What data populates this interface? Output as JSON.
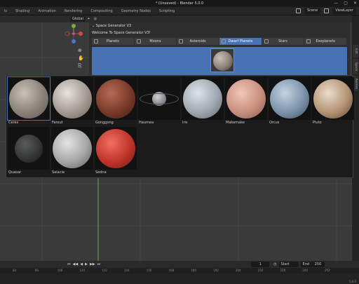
{
  "window": {
    "title": "* (Unsaved) - Blender 5.0.0",
    "controls": [
      "—",
      "▢",
      "✕"
    ]
  },
  "menubar": {
    "tabs": [
      "ls",
      "Shading",
      "Animation",
      "Rendering",
      "Compositing",
      "Geometry Nodes",
      "Scripting"
    ],
    "active_tab": "Scripting",
    "scene_label": "Scene",
    "view_layer_label": "ViewLayer"
  },
  "viewport_header": {
    "orientation": "Global"
  },
  "right_tabs": [
    "Edit",
    "Space",
    "Animes"
  ],
  "panel": {
    "header": "Space Generator V3",
    "welcome": "Welcome To Space Generator V3!",
    "categories": [
      "Planets",
      "Moons",
      "Asteroids",
      "Dwarf Planets",
      "Stars",
      "Exoplanets"
    ],
    "selected_category": "Dwarf Planets"
  },
  "grid": {
    "items": [
      {
        "label": "Ceres",
        "colors": [
          "#c9c2b8",
          "#8a8279",
          "#5d5750"
        ],
        "selected": true
      },
      {
        "label": "Farout",
        "colors": [
          "#e6e2dd",
          "#a39b93",
          "#6b5e55"
        ],
        "selected": false
      },
      {
        "label": "Gonggong",
        "colors": [
          "#b56b55",
          "#7a3a2a",
          "#3e1c14"
        ],
        "selected": false
      },
      {
        "label": "Haumea",
        "colors": [
          "#cfd2d6",
          "#8b9096",
          "#4d5157"
        ],
        "selected": false,
        "small": true
      },
      {
        "label": "Iris",
        "colors": [
          "#dde3e8",
          "#9fa8b0",
          "#5d656d"
        ],
        "selected": false
      },
      {
        "label": "Makemake",
        "colors": [
          "#f0c7b8",
          "#c98f7e",
          "#84584c"
        ],
        "selected": false
      },
      {
        "label": "Orcus",
        "colors": [
          "#c5d3e2",
          "#7c93aa",
          "#3e4f61"
        ],
        "selected": false
      },
      {
        "label": "Pluto",
        "colors": [
          "#e9dccb",
          "#b59476",
          "#5d4330"
        ],
        "selected": false
      },
      {
        "label": "Quaoar",
        "colors": [
          "#5a5b5a",
          "#353637",
          "#161718"
        ],
        "selected": false,
        "medium": true
      },
      {
        "label": "Salacia",
        "colors": [
          "#e4e4e4",
          "#a6a6a6",
          "#5a5a5a"
        ],
        "selected": false
      },
      {
        "label": "Sedna",
        "colors": [
          "#f07060",
          "#c0342a",
          "#6e1812"
        ],
        "selected": false
      }
    ]
  },
  "timeline": {
    "current_frame": "1",
    "start_label": "Start",
    "start_value": "1",
    "end_label": "End",
    "end_value": "250",
    "ticks": [
      "84",
      "96",
      "108",
      "120",
      "132",
      "144",
      "156",
      "168",
      "180",
      "192",
      "204",
      "216",
      "228",
      "240",
      "252"
    ],
    "version": "5.0.0"
  },
  "colors": {
    "accent": "#4772b3",
    "timeline_cursor": "#e8a64c"
  }
}
